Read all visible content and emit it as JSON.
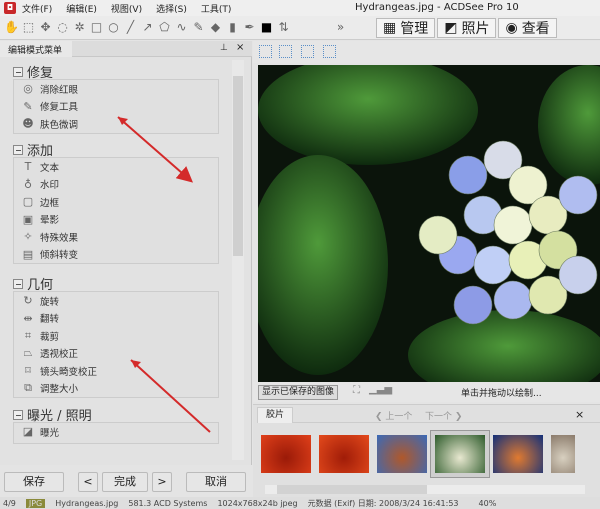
{
  "window": {
    "title": "Hydrangeas.jpg - ACDSee Pro 10"
  },
  "menu": [
    "文件(F)",
    "编辑(E)",
    "视图(V)",
    "选择(S)",
    "工具(T)"
  ],
  "modes": [
    {
      "label": "管理",
      "icon": "grid-icon"
    },
    {
      "label": "照片",
      "icon": "photos-icon"
    },
    {
      "label": "查看",
      "icon": "eye-icon"
    }
  ],
  "panel": {
    "title": "编辑模式菜单",
    "pin": "ᵖ",
    "close": "×",
    "sections": [
      {
        "title": "修复",
        "items": [
          {
            "label": "消除红眼",
            "icon": "◎"
          },
          {
            "label": "修复工具",
            "icon": "✎"
          },
          {
            "label": "肤色微调",
            "icon": "☻"
          }
        ]
      },
      {
        "title": "添加",
        "items": [
          {
            "label": "文本",
            "icon": "T"
          },
          {
            "label": "水印",
            "icon": "♁"
          },
          {
            "label": "边框",
            "icon": "▢"
          },
          {
            "label": "晕影",
            "icon": "▣"
          },
          {
            "label": "特殊效果",
            "icon": "✧"
          },
          {
            "label": "倾斜转变",
            "icon": "▤"
          }
        ]
      },
      {
        "title": "几何",
        "items": [
          {
            "label": "旋转",
            "icon": "↻"
          },
          {
            "label": "翻转",
            "icon": "⇹"
          },
          {
            "label": "裁剪",
            "icon": "⌗"
          },
          {
            "label": "透视校正",
            "icon": "⏢"
          },
          {
            "label": "镜头畸变校正",
            "icon": "⌑"
          },
          {
            "label": "调整大小",
            "icon": "⧉"
          }
        ]
      },
      {
        "title": "曝光 / 照明",
        "items": [
          {
            "label": "曝光",
            "icon": "◪"
          }
        ]
      }
    ]
  },
  "buttons": {
    "save": "保存",
    "prev": "<",
    "done": "完成",
    "next": ">",
    "cancel": "取消"
  },
  "viewer": {
    "show_saved": "显示已保存的图像",
    "hint": "单击并拖动以绘制..."
  },
  "filmstrip": {
    "tab": "胶片",
    "prev": "上一个",
    "next": "下一个",
    "close": "×",
    "thumbs": [
      {
        "colors": [
          "#e0401a",
          "#9a1a08"
        ]
      },
      {
        "colors": [
          "#e44a1c",
          "#a01c08"
        ]
      },
      {
        "colors": [
          "#3a6ab8",
          "#b0582a"
        ]
      },
      {
        "colors": [
          "#2c5a2a",
          "#e8e8d0"
        ]
      },
      {
        "colors": [
          "#12307a",
          "#e07a30"
        ]
      },
      {
        "colors": [
          "#8a7a6a",
          "#d8d0c0"
        ]
      }
    ],
    "selected": 3
  },
  "status": {
    "index": "4/9",
    "format": "JPG",
    "filename": "Hydrangeas.jpg",
    "size_author": "581.3 ACD Systems",
    "dims": "1024x768x24b jpeg",
    "meta": "元数据 (Exif) 日期: 2008/3/24 16:41:53",
    "zoom": "40%"
  },
  "annotation_color": "#d42a2a"
}
